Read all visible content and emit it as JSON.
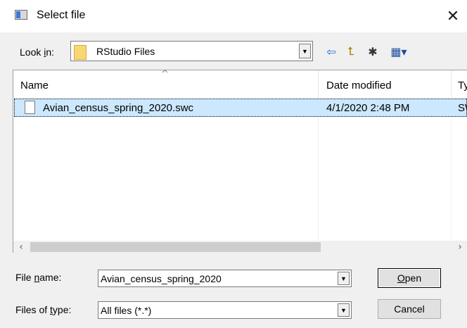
{
  "window": {
    "title": "Select file",
    "close_glyph": "✕"
  },
  "lookin": {
    "label_pre": "Look ",
    "label_hot": "i",
    "label_post": "n:",
    "value": "RStudio Files",
    "folder_icon": "folder-icon"
  },
  "toolbar": {
    "back_glyph": "⇦",
    "up_glyph": "⮤",
    "new_folder_glyph": "✱",
    "view_glyph": "▦▾"
  },
  "filelist": {
    "columns": [
      "Name",
      "Date modified",
      "Ty"
    ],
    "sort_caret": "^",
    "rows": [
      {
        "name": "Avian_census_spring_2020.swc",
        "date": "4/1/2020 2:48 PM",
        "type": "SWC"
      }
    ]
  },
  "scrollbar": {
    "left_glyph": "‹",
    "right_glyph": "›"
  },
  "form": {
    "filename_label_pre": "File ",
    "filename_label_hot": "n",
    "filename_label_post": "ame:",
    "filename_value": "Avian_census_spring_2020",
    "filetype_label_pre": "Files of ",
    "filetype_label_hot": "t",
    "filetype_label_post": "ype:",
    "filetype_value": "All files (*.*)",
    "dropdown_glyph": "▼"
  },
  "buttons": {
    "open_hot": "O",
    "open_rest": "pen",
    "cancel": "Cancel"
  }
}
